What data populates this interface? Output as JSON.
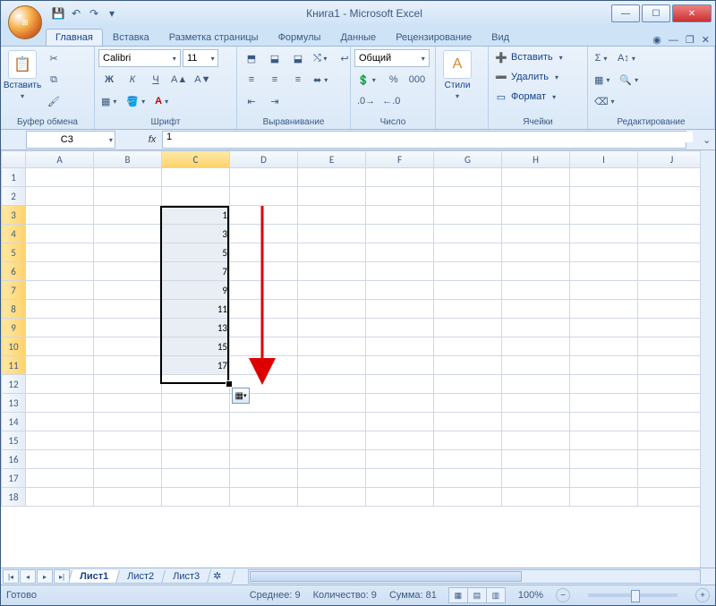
{
  "title": "Книга1 - Microsoft Excel",
  "tabs": {
    "home": "Главная",
    "insert": "Вставка",
    "layout": "Разметка страницы",
    "formulas": "Формулы",
    "data": "Данные",
    "review": "Рецензирование",
    "view": "Вид"
  },
  "ribbon": {
    "clipboard": {
      "paste": "Вставить",
      "label": "Буфер обмена"
    },
    "font": {
      "name": "Calibri",
      "size": "11",
      "bold": "Ж",
      "italic": "К",
      "underline": "Ч",
      "label": "Шрифт"
    },
    "alignment": {
      "label": "Выравнивание"
    },
    "number": {
      "format": "Общий",
      "label": "Число"
    },
    "styles": {
      "btn": "Стили",
      "label": ""
    },
    "cells": {
      "insert": "Вставить",
      "delete": "Удалить",
      "format": "Формат",
      "label": "Ячейки"
    },
    "editing": {
      "label": "Редактирование"
    }
  },
  "namebox": "C3",
  "formula": "1",
  "columns": [
    "A",
    "B",
    "C",
    "D",
    "E",
    "F",
    "G",
    "H",
    "I",
    "J"
  ],
  "rows": 18,
  "selected_col_index": 2,
  "selection": {
    "col": "C",
    "row_start": 3,
    "row_end": 11
  },
  "cells": {
    "C3": "1",
    "C4": "3",
    "C5": "5",
    "C6": "7",
    "C7": "9",
    "C8": "11",
    "C9": "13",
    "C10": "15",
    "C11": "17"
  },
  "sheets": {
    "s1": "Лист1",
    "s2": "Лист2",
    "s3": "Лист3"
  },
  "status": {
    "ready": "Готово",
    "avg": "Среднее: 9",
    "count": "Количество: 9",
    "sum": "Сумма: 81",
    "zoom": "100%"
  }
}
